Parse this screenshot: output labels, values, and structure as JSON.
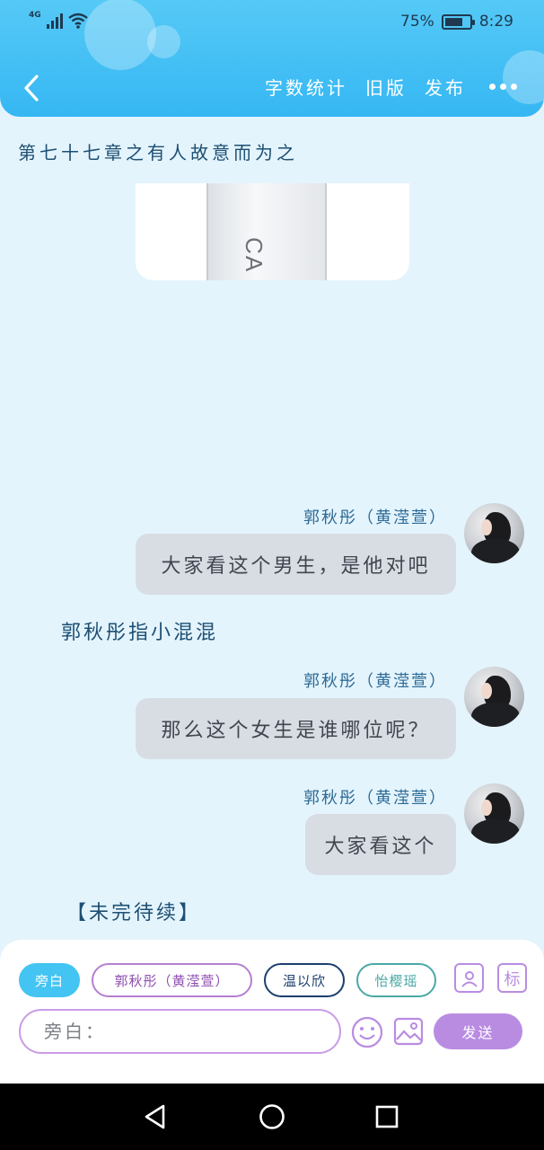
{
  "status_bar": {
    "network": "4G",
    "battery_percent": "75%",
    "battery_level": 0.75,
    "time": "8:29"
  },
  "header": {
    "actions": [
      "字数统计",
      "旧版",
      "发布"
    ]
  },
  "chapter_title": "第七十七章之有人故意而为之",
  "image_card": {
    "label": "CA"
  },
  "messages": [
    {
      "speaker": "郭秋彤（黄滢萱）",
      "text": "大家看这个男生，是他对吧"
    },
    {
      "narration": "郭秋彤指小混混"
    },
    {
      "speaker": "郭秋彤（黄滢萱）",
      "text": "那么这个女生是谁哪位呢？"
    },
    {
      "speaker": "郭秋彤（黄滢萱）",
      "text": "大家看这个"
    }
  ],
  "ending": "【未完待续】",
  "input_panel": {
    "chips": [
      "旁白",
      "郭秋彤（黄滢萱）",
      "温以欣",
      "怡樱瑶"
    ],
    "tag_icon_label": "标",
    "input_placeholder": "旁白：",
    "send_label": "发送"
  },
  "colors": {
    "header": "#36b7f3",
    "page_bg": "#e4f4fd",
    "accent_purple": "#b98ce2",
    "bubble": "#d8dde3"
  },
  "icons": [
    "back-icon",
    "more-icon",
    "contact-icon",
    "tag-icon",
    "emoji-icon",
    "image-icon",
    "nav-back-icon",
    "nav-home-icon",
    "nav-recents-icon"
  ]
}
